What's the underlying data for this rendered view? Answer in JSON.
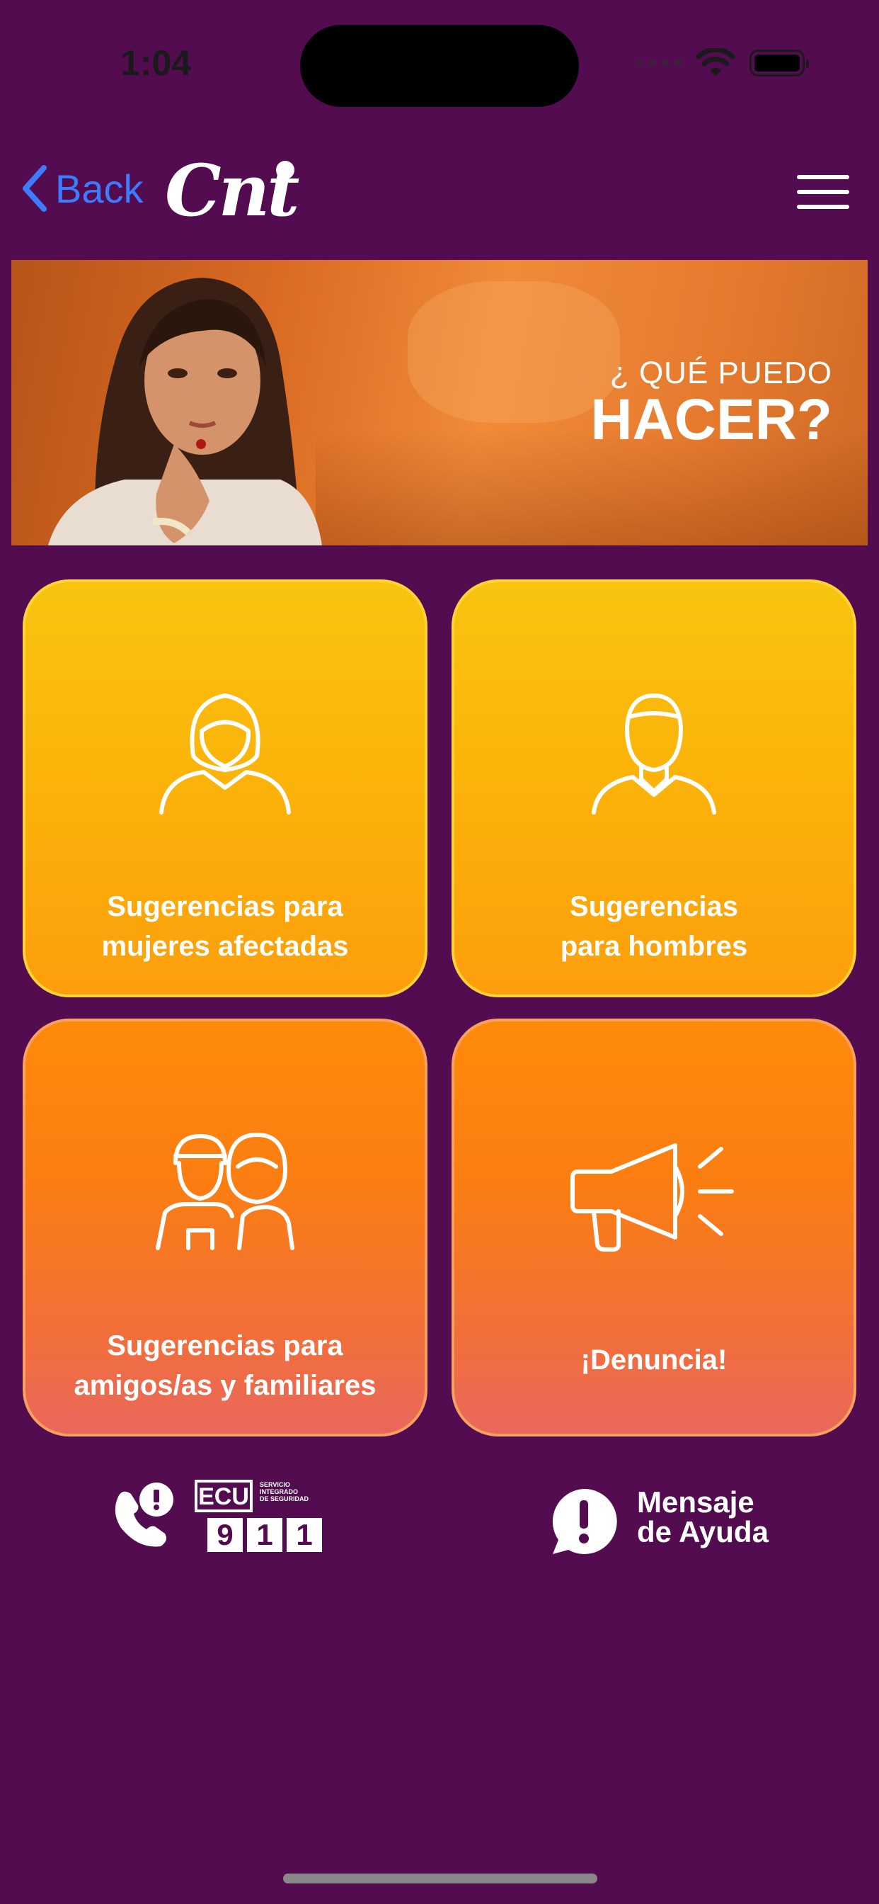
{
  "status_bar": {
    "time": "1:04"
  },
  "nav": {
    "back_label": "Back",
    "logo_text": "Cnt"
  },
  "banner": {
    "line1": "¿ QUÉ PUEDO",
    "line2": "HACER?"
  },
  "tiles": [
    {
      "line1": "Sugerencias para",
      "line2": "mujeres afectadas",
      "icon": "woman-icon"
    },
    {
      "line1": "Sugerencias",
      "line2": "para hombres",
      "icon": "man-icon"
    },
    {
      "line1": "Sugerencias para",
      "line2": "amigos/as y familiares",
      "icon": "friends-family-icon"
    },
    {
      "line1": "¡Denuncia!",
      "line2": "",
      "icon": "megaphone-icon"
    }
  ],
  "footer": {
    "ecu_label": "ECU",
    "ecu_subtitle_1": "SERVICIO",
    "ecu_subtitle_2": "INTEGRADO",
    "ecu_subtitle_3": "DE SEGURIDAD",
    "ecu_digit_1": "9",
    "ecu_digit_2": "1",
    "ecu_digit_3": "1",
    "help_line1": "Mensaje",
    "help_line2": "de Ayuda"
  },
  "colors": {
    "background": "#520c4f",
    "back_link": "#3d7bff",
    "tile_yellow": "#f8c410",
    "tile_orange": "#ff8a0a"
  }
}
